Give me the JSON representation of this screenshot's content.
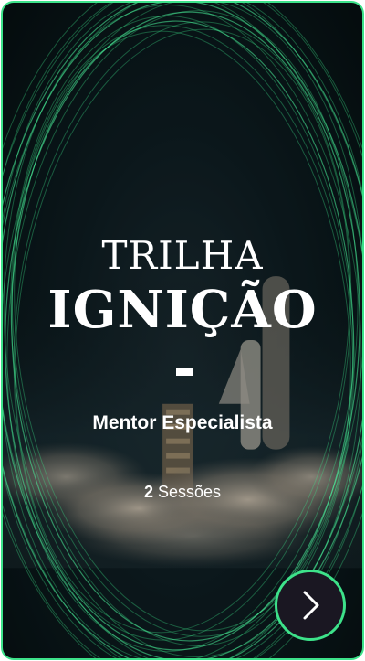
{
  "card": {
    "title_line1": "TRILHA",
    "title_line2": "IGNIÇÃO",
    "subtitle": "Mentor Especialista",
    "sessions_count": "2",
    "sessions_label": "Sessões"
  },
  "navigation": {
    "next_icon": "chevron-right-icon"
  },
  "colors": {
    "accent": "#3de28a",
    "background": "#071214",
    "button_bg": "#1a1722",
    "text": "#ffffff"
  }
}
